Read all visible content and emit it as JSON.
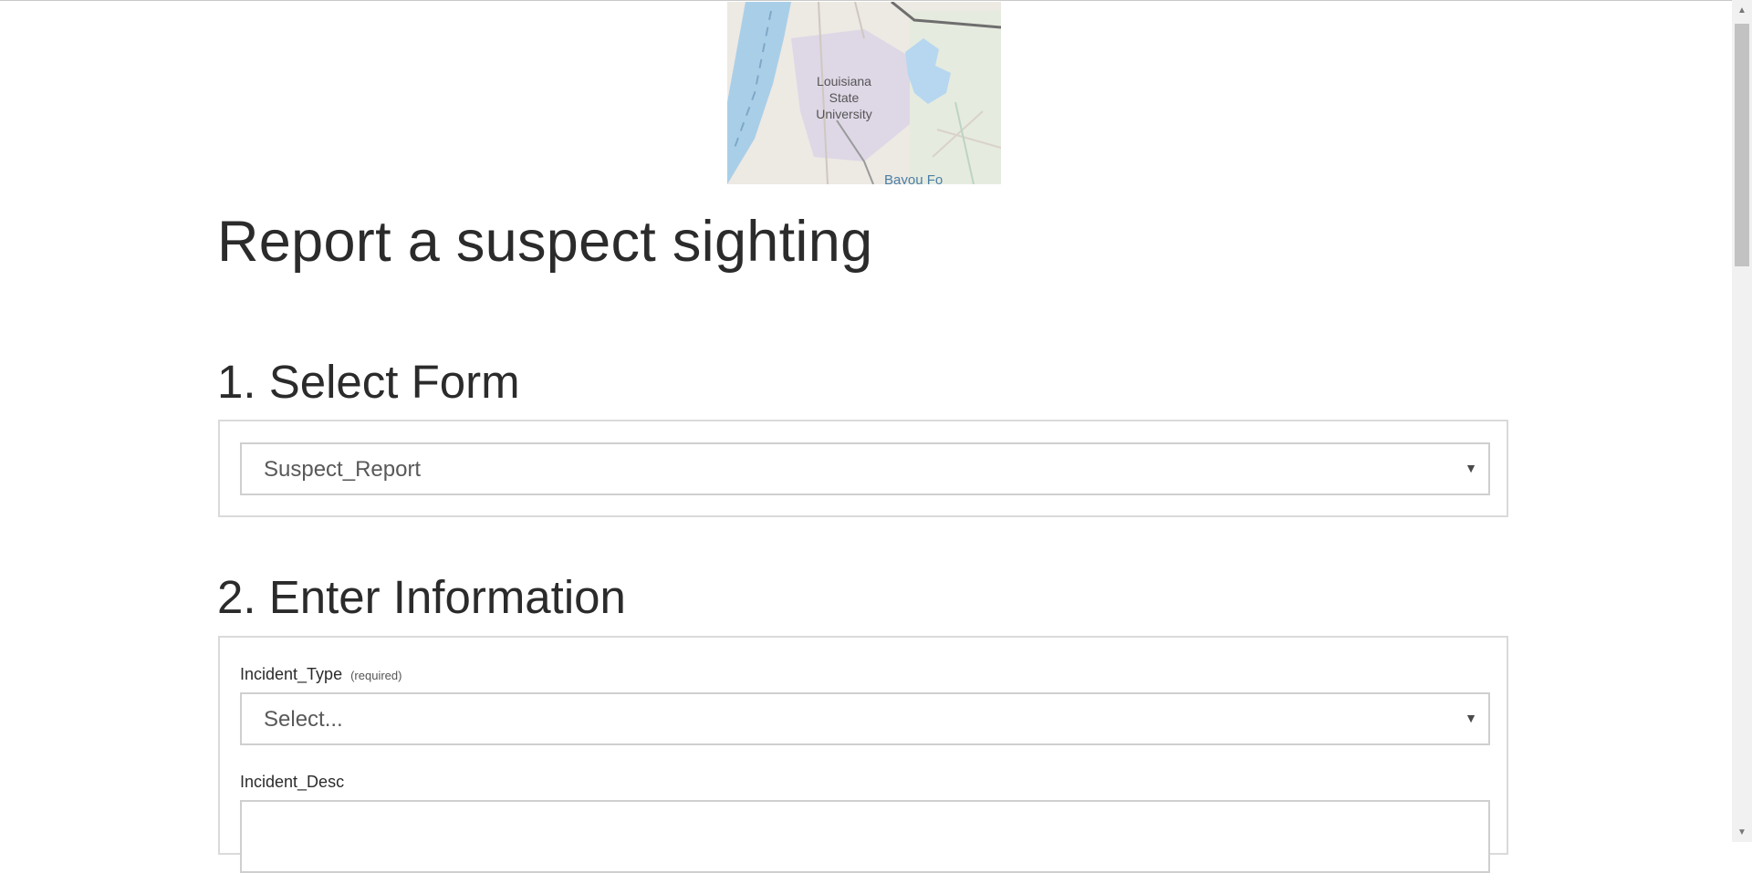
{
  "map": {
    "place_label_line1": "Louisiana",
    "place_label_line2": "State",
    "place_label_line3": "University",
    "water_label": "Bayou Fo"
  },
  "page_title": "Report a suspect sighting",
  "sections": {
    "select_form": {
      "heading": "1. Select Form",
      "selected_value": "Suspect_Report"
    },
    "enter_information": {
      "heading": "2. Enter Information",
      "incident_type_label": "Incident_Type",
      "incident_type_required": "(required)",
      "incident_type_value": "Select...",
      "incident_desc_label": "Incident_Desc"
    }
  },
  "icons": {
    "dropdown_caret": "▼",
    "scroll_up": "▲",
    "scroll_down": "▼"
  }
}
